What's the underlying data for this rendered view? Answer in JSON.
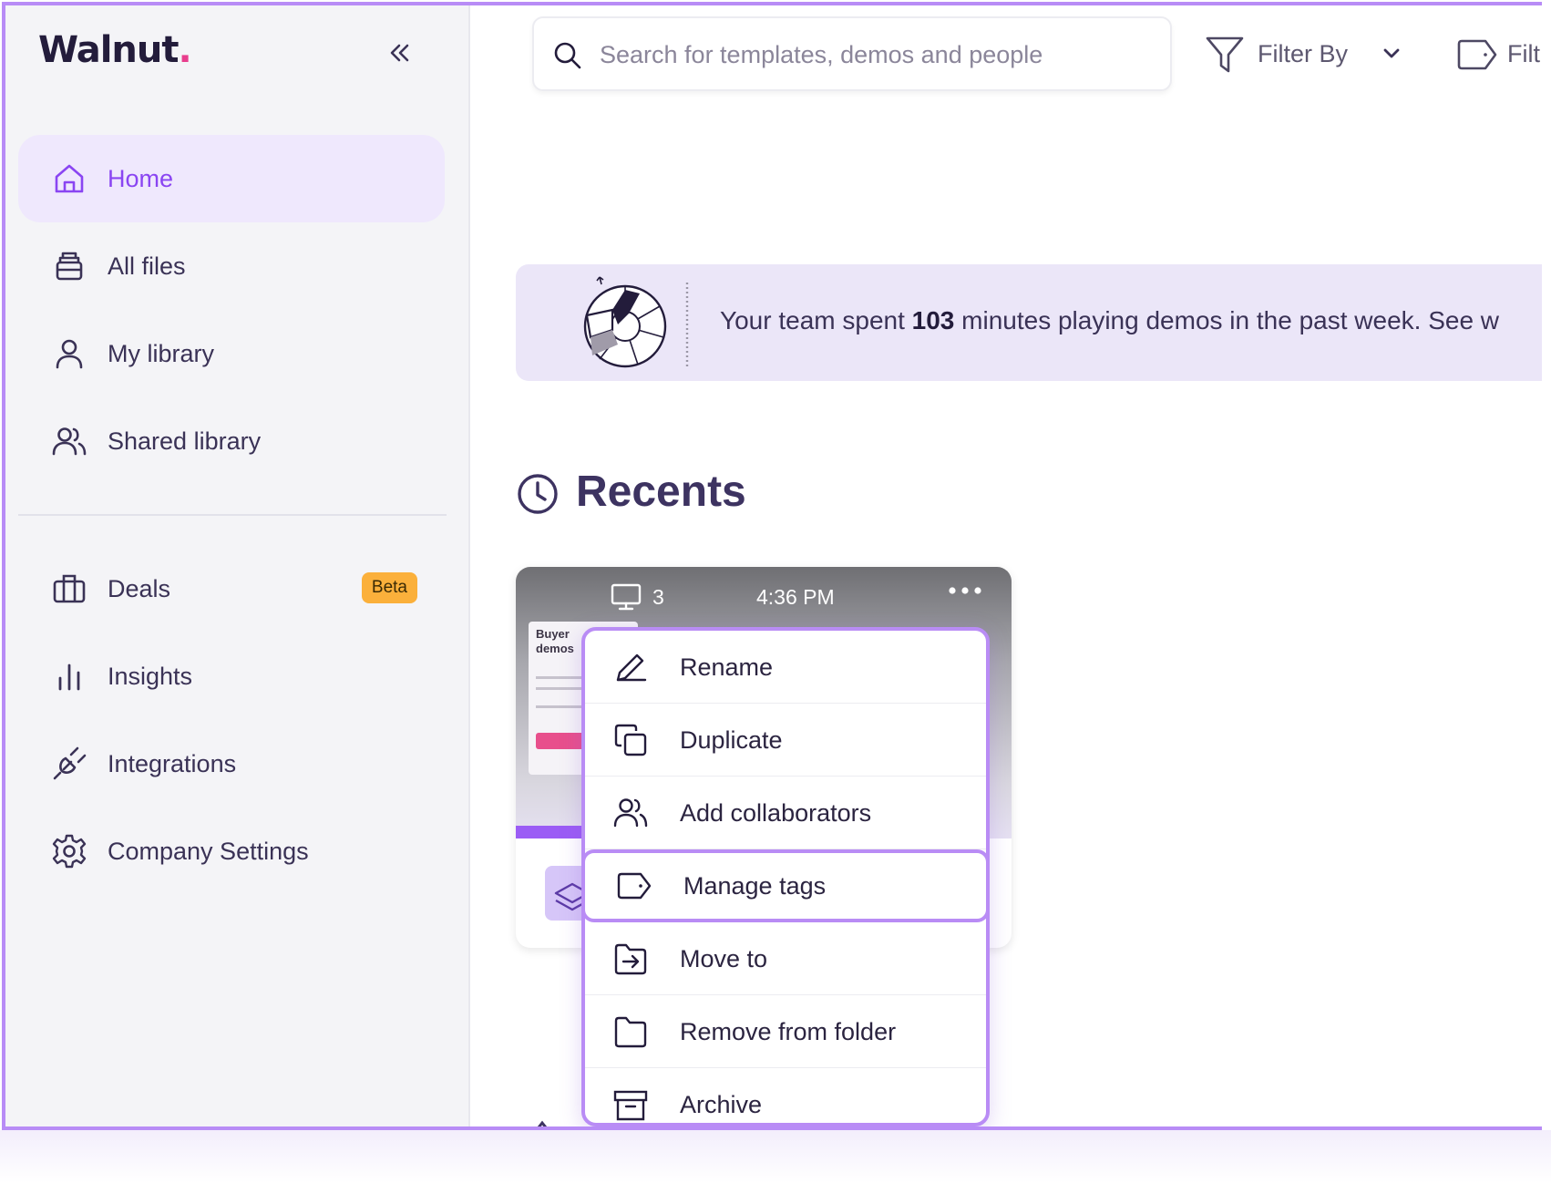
{
  "sidebar": {
    "logo": {
      "text": "Walnut",
      "dot": "."
    },
    "collapse_icon": "double-chevron-left-icon",
    "primary_items": [
      {
        "label": "Home",
        "icon": "home-icon",
        "active": true
      },
      {
        "label": "All files",
        "icon": "files-icon",
        "active": false
      },
      {
        "label": "My library",
        "icon": "user-icon",
        "active": false
      },
      {
        "label": "Shared library",
        "icon": "users-icon",
        "active": false
      }
    ],
    "secondary_items": [
      {
        "label": "Deals",
        "icon": "briefcase-icon",
        "badge": "Beta"
      },
      {
        "label": "Insights",
        "icon": "bar-chart-icon"
      },
      {
        "label": "Integrations",
        "icon": "plug-icon"
      },
      {
        "label": "Company Settings",
        "icon": "gear-icon"
      }
    ]
  },
  "topbar": {
    "search_placeholder": "Search for templates, demos and people",
    "filter_label": "Filter By",
    "tag_filter_label": "Filt"
  },
  "banner": {
    "prefix": "Your team spent ",
    "minutes": "103",
    "suffix": " minutes playing demos in the past week. See w"
  },
  "recents": {
    "title": "Recents",
    "card": {
      "screen_count": "3",
      "time": "4:36 PM",
      "thumb_title": "Buyer\ndemos"
    }
  },
  "context_menu": {
    "items": [
      {
        "label": "Rename",
        "icon": "pencil-icon"
      },
      {
        "label": "Duplicate",
        "icon": "duplicate-icon"
      },
      {
        "label": "Add collaborators",
        "icon": "users-icon"
      },
      {
        "label": "Manage tags",
        "icon": "tag-icon",
        "highlighted": true
      },
      {
        "label": "Move to",
        "icon": "folder-move-icon"
      },
      {
        "label": "Remove from folder",
        "icon": "folder-icon"
      },
      {
        "label": "Archive",
        "icon": "archive-icon"
      }
    ]
  },
  "colors": {
    "accent": "#8a45f2",
    "highlight_border": "#b98cf5",
    "beta_badge": "#fbb03b",
    "banner_bg": "#ebe6f8",
    "logo_dot": "#e83d8d"
  }
}
